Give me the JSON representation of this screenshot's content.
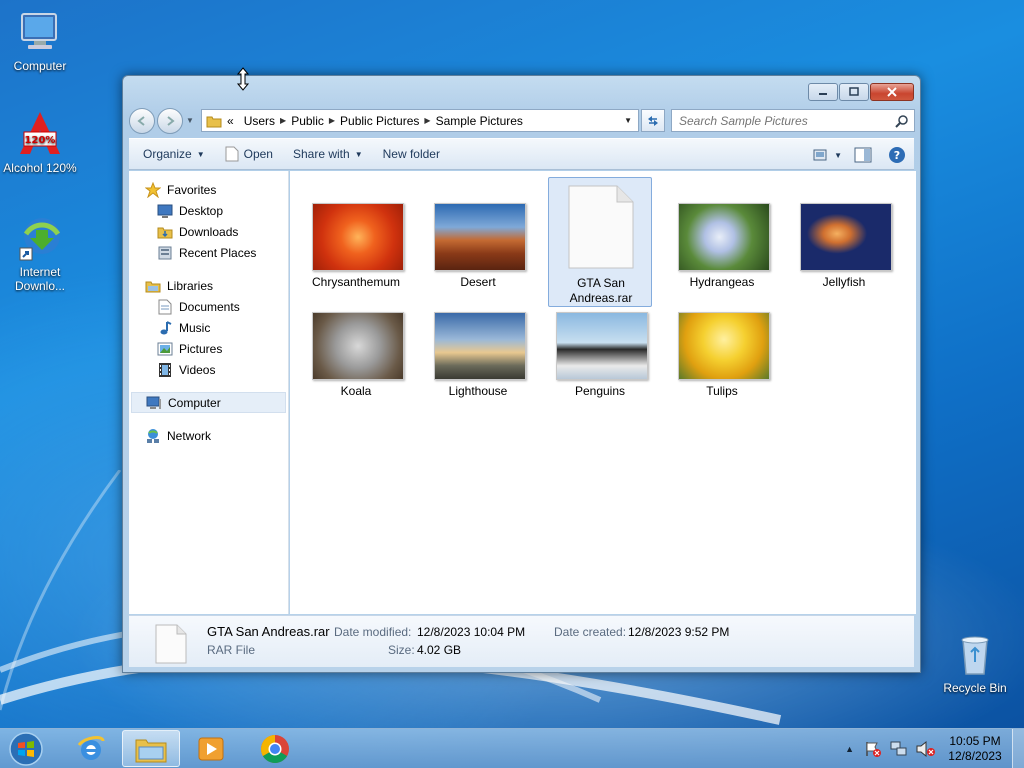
{
  "desktop": {
    "icons": [
      {
        "label": "Computer"
      },
      {
        "label": "Alcohol 120%"
      },
      {
        "label_line1": "Internet",
        "label_line2": "Downlo..."
      },
      {
        "label": "Recycle Bin"
      }
    ]
  },
  "window": {
    "address": {
      "overflow": "«",
      "crumbs": [
        "Users",
        "Public",
        "Public Pictures",
        "Sample Pictures"
      ]
    },
    "search": {
      "placeholder": "Search Sample Pictures"
    },
    "toolbar": {
      "organize": "Organize",
      "open": "Open",
      "share_with": "Share with",
      "new_folder": "New folder"
    },
    "nav": {
      "favorites": "Favorites",
      "desktop": "Desktop",
      "downloads": "Downloads",
      "recent_places": "Recent Places",
      "libraries": "Libraries",
      "documents": "Documents",
      "music": "Music",
      "pictures": "Pictures",
      "videos": "Videos",
      "computer": "Computer",
      "network": "Network"
    },
    "files": [
      {
        "name": "Chrysanthemum"
      },
      {
        "name": "Desert"
      },
      {
        "name_line1": "GTA San",
        "name_line2": "Andreas.rar",
        "selected": true
      },
      {
        "name": "Hydrangeas"
      },
      {
        "name": "Jellyfish"
      },
      {
        "name": "Koala"
      },
      {
        "name": "Lighthouse"
      },
      {
        "name": "Penguins"
      },
      {
        "name": "Tulips"
      }
    ],
    "details": {
      "file_name": "GTA San Andreas.rar",
      "file_type": "RAR File",
      "date_modified_label": "Date modified:",
      "date_modified": "12/8/2023 10:04 PM",
      "size_label": "Size:",
      "size": "4.02 GB",
      "date_created_label": "Date created:",
      "date_created": "12/8/2023 9:52 PM"
    }
  },
  "taskbar": {
    "time": "10:05 PM",
    "date": "12/8/2023"
  },
  "colors": {
    "accent": "#1d73c9",
    "selection": "#dde9f8",
    "close_button": "#c9452f"
  }
}
